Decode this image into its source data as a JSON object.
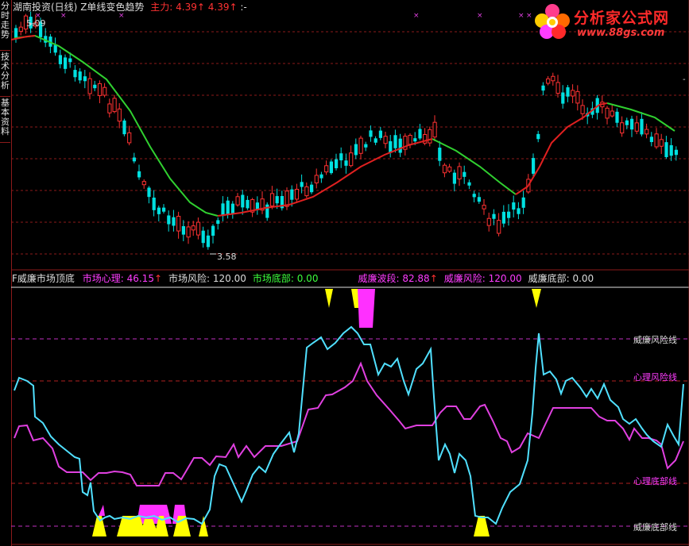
{
  "sidebar": {
    "tabs": [
      {
        "label": "分时走势"
      },
      {
        "label": "技术分析"
      },
      {
        "label": "基本资料"
      }
    ]
  },
  "top_panel": {
    "title": "湖南投资(日线)",
    "indicator": "Z单线变色趋势",
    "main_force_label": "主力:",
    "value1": "4.39",
    "value2": "4.39",
    "value3": "-",
    "arrow": "↑",
    "high_label": "5.09",
    "low_label": "3.58"
  },
  "logo": {
    "text": "分析家公式网",
    "url": "www.88gs.com"
  },
  "bottom_panel": {
    "title": "F威廉市场顶底",
    "items": [
      {
        "label": "市场心理:",
        "value": "46.15",
        "arrow": "↑",
        "color": "#ff3cff"
      },
      {
        "label": "市场风险:",
        "value": "120.00",
        "arrow": "",
        "color": "#dcdcdc"
      },
      {
        "label": "市场底部:",
        "value": "0.00",
        "arrow": "",
        "color": "#3cff3c"
      },
      {
        "label": "威廉波段:",
        "value": "82.88",
        "arrow": "↑",
        "color": "#ff3cff"
      },
      {
        "label": "威廉风险:",
        "value": "120.00",
        "arrow": "",
        "color": "#ff3cff"
      },
      {
        "label": "威廉底部:",
        "value": "0.00",
        "arrow": "",
        "color": "#dcdcdc"
      }
    ],
    "line_labels": {
      "wl_risk": "威廉风险线",
      "psy_risk": "心理风险线",
      "psy_bottom": "心理底部线",
      "wl_bottom": "威廉底部线"
    }
  },
  "colors": {
    "up_candle": "#ff3232",
    "down_candle": "#00e0e0",
    "ma_up": "#e02020",
    "ma_down": "#30d030",
    "williams": "#50e0ff",
    "psych": "#e040e0",
    "signal_yellow": "#ffff00",
    "signal_magenta": "#ff30ff",
    "grid_red": "#8b1a1a"
  }
}
